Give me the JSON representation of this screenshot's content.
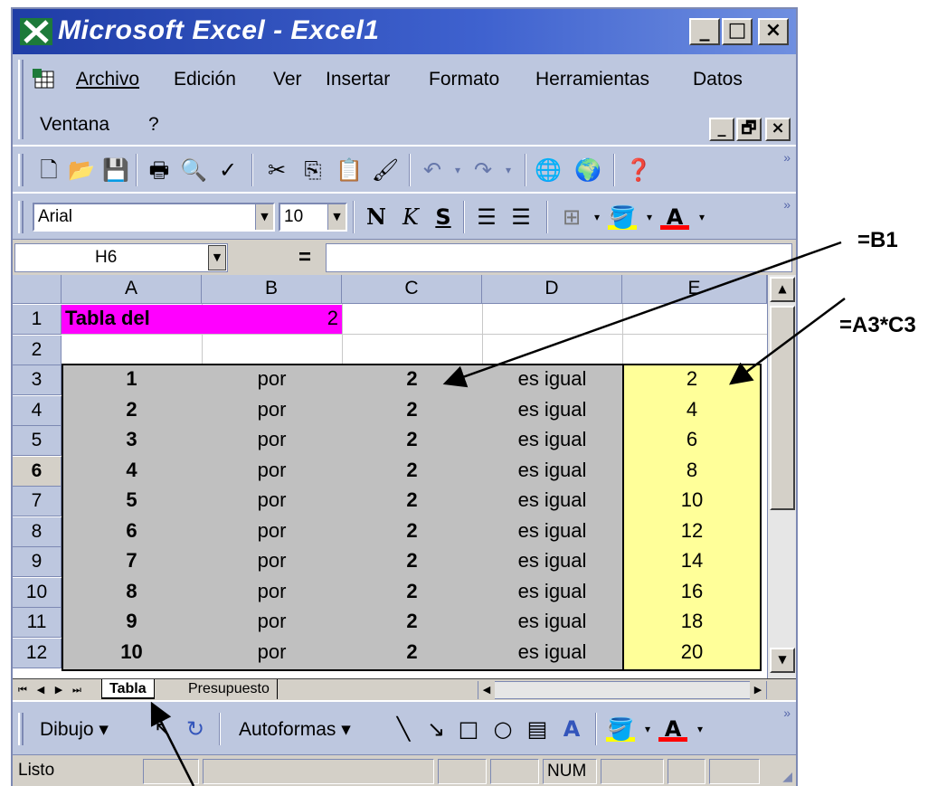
{
  "window": {
    "title": "Microsoft Excel - Excel1"
  },
  "title_buttons": {
    "minimize": "_",
    "maximize": "□",
    "close": "×"
  },
  "menu": {
    "items": [
      "Archivo",
      "Edición",
      "Ver",
      "Insertar",
      "Formato",
      "Herramientas",
      "Datos",
      "Ventana",
      "?"
    ],
    "mdi_min": "_",
    "mdi_restore": "🗗",
    "mdi_close": "×"
  },
  "toolbar_standard": {
    "icons": [
      "new-document-icon",
      "open-folder-icon",
      "save-disk-icon",
      "print-icon",
      "print-preview-icon",
      "spelling-icon",
      "cut-icon",
      "copy-icon",
      "paste-icon",
      "format-painter-icon",
      "undo-icon",
      "redo-icon",
      "web-toolbar-icon",
      "globe-icon",
      "help-icon"
    ]
  },
  "toolbar_format": {
    "font": "Arial",
    "size": "10",
    "bold": "N",
    "italic": "K",
    "underline": "S"
  },
  "formula_bar": {
    "name_box": "H6",
    "equals": "=",
    "formula": ""
  },
  "sheet": {
    "columns": [
      "A",
      "B",
      "C",
      "D",
      "E"
    ],
    "rows": [
      "1",
      "2",
      "3",
      "4",
      "5",
      "6",
      "7",
      "8",
      "9",
      "10",
      "11",
      "12"
    ],
    "header": {
      "title": "Tabla del",
      "value": "2"
    },
    "table": [
      {
        "a": "1",
        "b": "por",
        "c": "2",
        "d": "es igual",
        "e": "2"
      },
      {
        "a": "2",
        "b": "por",
        "c": "2",
        "d": "es igual",
        "e": "4"
      },
      {
        "a": "3",
        "b": "por",
        "c": "2",
        "d": "es igual",
        "e": "6"
      },
      {
        "a": "4",
        "b": "por",
        "c": "2",
        "d": "es igual",
        "e": "8"
      },
      {
        "a": "5",
        "b": "por",
        "c": "2",
        "d": "es igual",
        "e": "10"
      },
      {
        "a": "6",
        "b": "por",
        "c": "2",
        "d": "es igual",
        "e": "12"
      },
      {
        "a": "7",
        "b": "por",
        "c": "2",
        "d": "es igual",
        "e": "14"
      },
      {
        "a": "8",
        "b": "por",
        "c": "2",
        "d": "es igual",
        "e": "16"
      },
      {
        "a": "9",
        "b": "por",
        "c": "2",
        "d": "es igual",
        "e": "18"
      },
      {
        "a": "10",
        "b": "por",
        "c": "2",
        "d": "es igual",
        "e": "20"
      }
    ],
    "selected_row": "6",
    "colors": {
      "title_fill": "#ff00ff",
      "table_fill": "#c0c0c0",
      "result_fill": "#ffff99"
    }
  },
  "tabs": {
    "active": "Tabla",
    "other": "Presupuesto"
  },
  "drawing": {
    "dibujo": "Dibujo",
    "autoformas": "Autoformas"
  },
  "status": {
    "ready": "Listo",
    "num": "NUM"
  },
  "annotations": {
    "ref_b1": "=B1",
    "ref_formula": "=A3*C3"
  }
}
